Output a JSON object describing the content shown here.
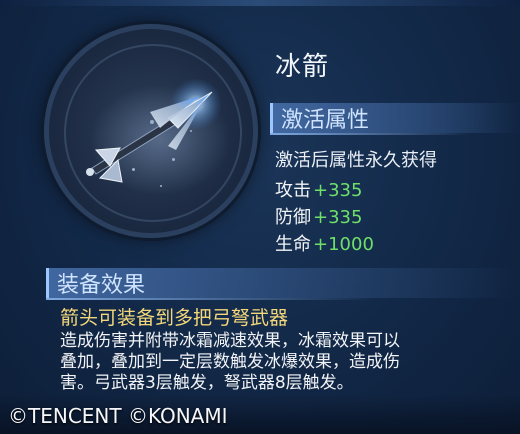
{
  "item": {
    "name": "冰箭",
    "icon": "ice-arrow-icon"
  },
  "activation": {
    "header": "激活属性",
    "note": "激活后属性永久获得",
    "stats": [
      {
        "name": "攻击",
        "value": "+335"
      },
      {
        "name": "防御",
        "value": "+335"
      },
      {
        "name": "生命",
        "value": "+1000"
      }
    ]
  },
  "equip": {
    "header": "装备效果",
    "subtitle": "箭头可装备到多把弓弩武器",
    "description_lines": [
      "造成伤害并附带冰霜减速效果，冰霜效果可以",
      "叠加，叠加到一定层数触发冰爆效果，造成伤",
      "害。弓武器3层触发，弩武器8层触发。"
    ]
  },
  "copyright": "©TENCENT ©KONAMI",
  "colors": {
    "stat_value": "#6ee06a",
    "equip_subtitle": "#f3d77a",
    "header_text": "#cfe4ff",
    "background": "#132a4a"
  }
}
